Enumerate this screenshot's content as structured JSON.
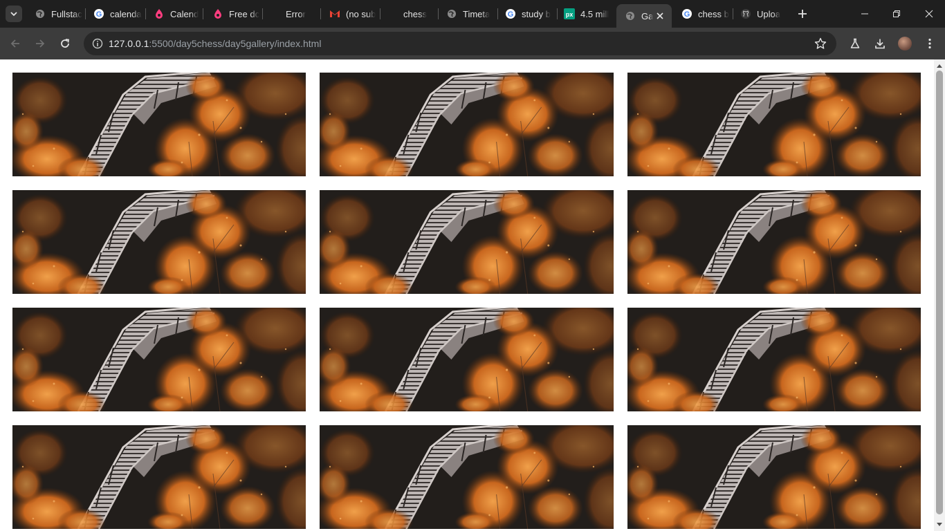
{
  "browser": {
    "tabs": [
      {
        "title": "Fullstac",
        "favicon": "globe-icon"
      },
      {
        "title": "calenda",
        "favicon": "google-icon"
      },
      {
        "title": "Calend",
        "favicon": "drop-icon"
      },
      {
        "title": "Free dc",
        "favicon": "drop-icon"
      },
      {
        "title": "Error",
        "favicon": "none"
      },
      {
        "title": "(no sub",
        "favicon": "gmail-icon"
      },
      {
        "title": "chess",
        "favicon": "none"
      },
      {
        "title": "Timeta",
        "favicon": "globe-icon"
      },
      {
        "title": "study b",
        "favicon": "google-icon"
      },
      {
        "title": "4.5 mill",
        "favicon": "px-icon"
      },
      {
        "title": "Ga",
        "favicon": "globe-icon",
        "active": true
      },
      {
        "title": "chess b",
        "favicon": "google-icon"
      },
      {
        "title": "Uploa",
        "favicon": "github-icon"
      }
    ],
    "url_host": "127.0.0.1",
    "url_path": ":5500/day5chess/day5gallery/index.html"
  },
  "gallery": {
    "rows": 4,
    "columns": 3,
    "photo_subject": "wooden boardwalk with orange autumn trees"
  },
  "colors": {
    "tabstrip_bg": "#1f1f1f",
    "toolbar_bg": "#3c3c3c",
    "omnibox_bg": "#282828",
    "foliage_orange": "#c8661e"
  }
}
